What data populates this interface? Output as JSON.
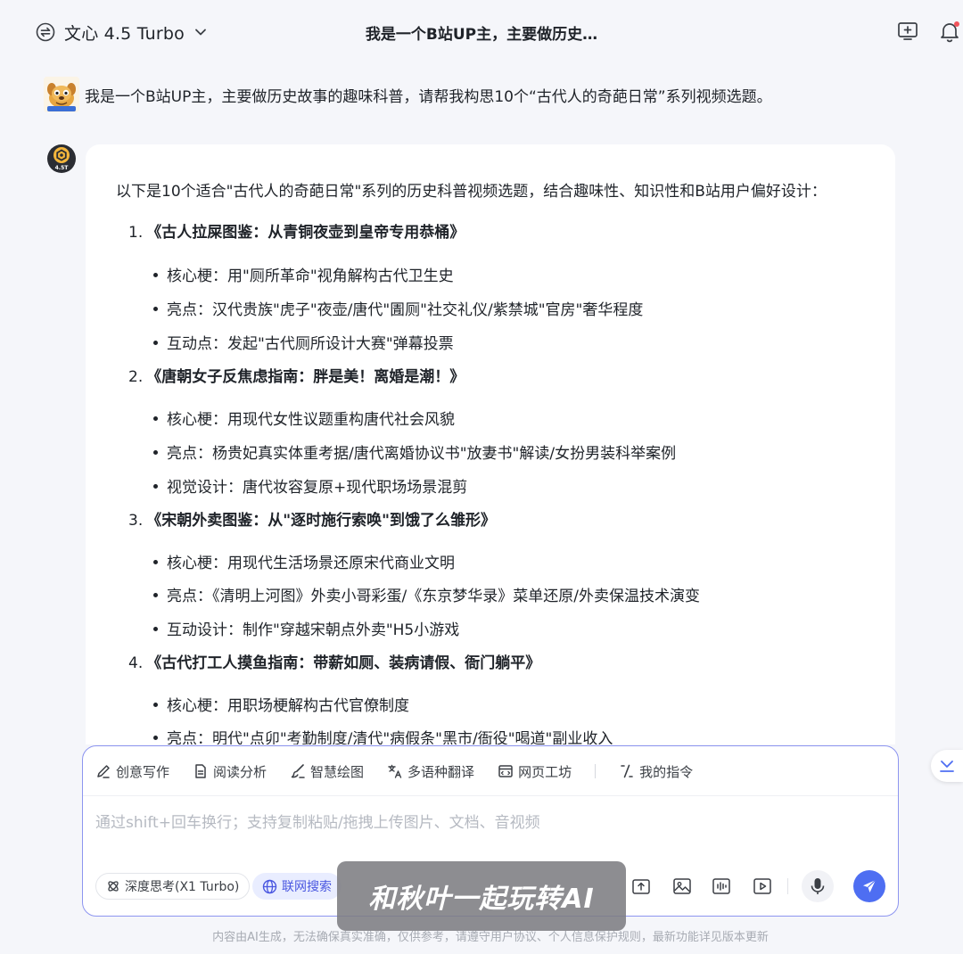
{
  "header": {
    "model_name": "文心 4.5 Turbo",
    "title": "我是一个B站UP主，主要做历史…",
    "icons": [
      "model-switch-icon",
      "chevron-down-icon",
      "new-chat-icon",
      "notification-bell-icon"
    ]
  },
  "user_message": {
    "text": "我是一个B站UP主，主要做历史故事的趣味科普，请帮我构思10个“古代人的奇葩日常”系列视频选题。"
  },
  "bot_reply": {
    "intro": "以下是10个适合\"古代人的奇葩日常\"系列的历史科普视频选题，结合趣味性、知识性和B站用户偏好设计：",
    "topics": [
      {
        "num": "1.",
        "title": "《古人拉屎图鉴：从青铜夜壶到皇帝专用恭桶》",
        "points": [
          "核心梗：用\"厕所革命\"视角解构古代卫生史",
          "亮点：汉代贵族\"虎子\"夜壶/唐代\"圊厕\"社交礼仪/紫禁城\"官房\"奢华程度",
          "互动点：发起\"古代厕所设计大赛\"弹幕投票"
        ]
      },
      {
        "num": "2.",
        "title": "《唐朝女子反焦虑指南：胖是美！离婚是潮！》",
        "points": [
          "核心梗：用现代女性议题重构唐代社会风貌",
          "亮点：杨贵妃真实体重考据/唐代离婚协议书\"放妻书\"解读/女扮男装科举案例",
          "视觉设计：唐代妆容复原+现代职场场景混剪"
        ]
      },
      {
        "num": "3.",
        "title": "《宋朝外卖图鉴：从\"逐时施行索唤\"到饿了么雏形》",
        "points": [
          "核心梗：用现代生活场景还原宋代商业文明",
          "亮点：《清明上河图》外卖小哥彩蛋/《东京梦华录》菜单还原/外卖保温技术演变",
          "互动设计：制作\"穿越宋朝点外卖\"H5小游戏"
        ]
      },
      {
        "num": "4.",
        "title": "《古代打工人摸鱼指南：带薪如厕、装病请假、衙门躺平》",
        "points": [
          "核心梗：用职场梗解构古代官僚制度",
          "亮点：明代\"点卯\"考勤制度/清代\"病假条\"黑市/衙役\"喝道\"副业收入"
        ]
      }
    ]
  },
  "composer": {
    "tools": [
      {
        "label": "创意写作",
        "icon": "pen-icon"
      },
      {
        "label": "阅读分析",
        "icon": "document-icon"
      },
      {
        "label": "智慧绘图",
        "icon": "brush-icon"
      },
      {
        "label": "多语种翻译",
        "icon": "translate-icon"
      },
      {
        "label": "网页工坊",
        "icon": "webpage-icon"
      },
      {
        "label": "我的指令",
        "icon": "slash-command-icon"
      }
    ],
    "placeholder": "通过shift+回车换行；支持复制粘贴/拖拽上传图片、文档、音视频",
    "deep_think_label": "深度思考(X1 Turbo)",
    "web_search_label": "联网搜索",
    "attachments": [
      "upload-file-icon",
      "image-icon",
      "audio-icon",
      "video-icon"
    ]
  },
  "watermark": "和秋叶一起玩转AI",
  "disclaimer": "内容由AI生成，无法确保真实准确，仅供参考，请遵守用户协议、个人信息保护规则，最新功能详见版本更新",
  "colors": {
    "background": "#f5f6fa",
    "accent": "#4e6ef2",
    "composer_border": "#8d95f0",
    "web_search_bg": "#e9edff",
    "text": "#1f2329"
  }
}
